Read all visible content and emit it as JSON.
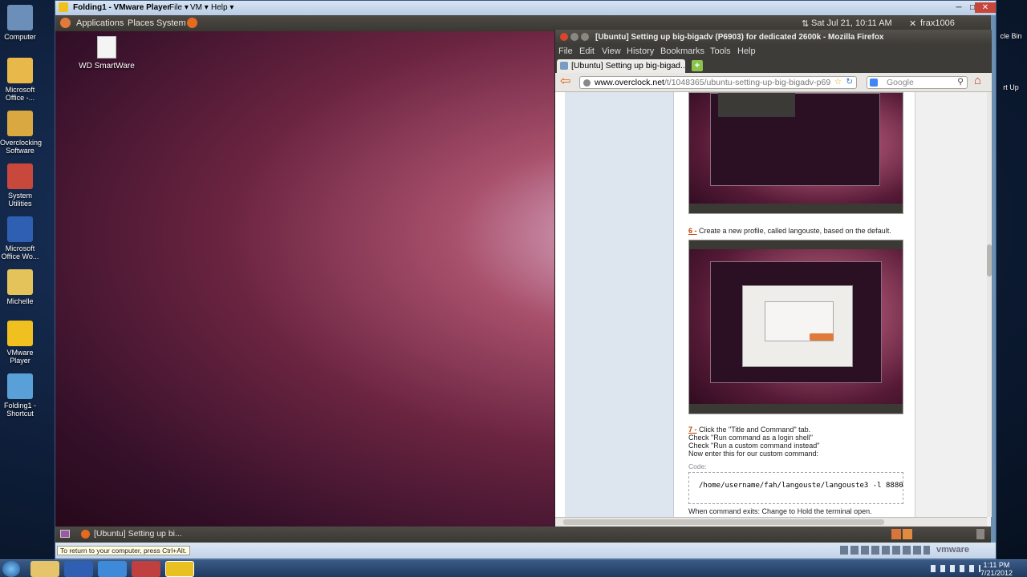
{
  "desktop": {
    "icons": [
      {
        "label": "Computer"
      },
      {
        "label": "Microsoft Office -..."
      },
      {
        "label": "Overclocking Software"
      },
      {
        "label": "System Utilities"
      },
      {
        "label": "Microsoft Office Wo..."
      },
      {
        "label": "Michelle"
      },
      {
        "label": "VMware Player"
      },
      {
        "label": "Folding1 - Shortcut"
      }
    ],
    "right_labels": {
      "top": "cle Bin",
      "mid": "rt Up"
    }
  },
  "vmware": {
    "title": "Folding1 - VMware Player",
    "menu": [
      "File ▾",
      "VM ▾",
      "Help ▾"
    ],
    "status_hint": "To return to your computer, press Ctrl+Alt.",
    "logo": "vmware"
  },
  "ubuntu": {
    "panel_menu": [
      "Applications",
      "Places",
      "System"
    ],
    "datetime": "Sat Jul 21, 10:11 AM",
    "user": "frax1006",
    "desktop_icon": "WD SmartWare",
    "task_label": "[Ubuntu] Setting up bi..."
  },
  "firefox": {
    "title": "[Ubuntu] Setting up big-bigadv (P6903) for dedicated 2600k - Mozilla Firefox",
    "menu": [
      "File",
      "Edit",
      "View",
      "History",
      "Bookmarks",
      "Tools",
      "Help"
    ],
    "tab": "[Ubuntu] Setting up big-bigad...",
    "url_host": "www.overclock.net",
    "url_path": "/t/1048365/ubuntu-setting-up-big-bigadv-p69",
    "search_placeholder": "Google"
  },
  "article": {
    "step6_num": "6 -",
    "step6_text": "Create a new profile, called langouste, based on the default.",
    "step7_num": "7 -",
    "step7_lines": [
      "Click the \"Title and Command\" tab.",
      "Check \"Run command as a login shell\"",
      "Check \"Run a custom command instead\"",
      "Now enter this for our custom command:"
    ],
    "code_label": "Code:",
    "code": "/home/username/fah/langouste/langouste3 -l 8880",
    "after_code": "When command exits: Change to Hold the terminal open."
  },
  "taskbar": {
    "time": "1:11 PM",
    "date": "7/21/2012"
  }
}
